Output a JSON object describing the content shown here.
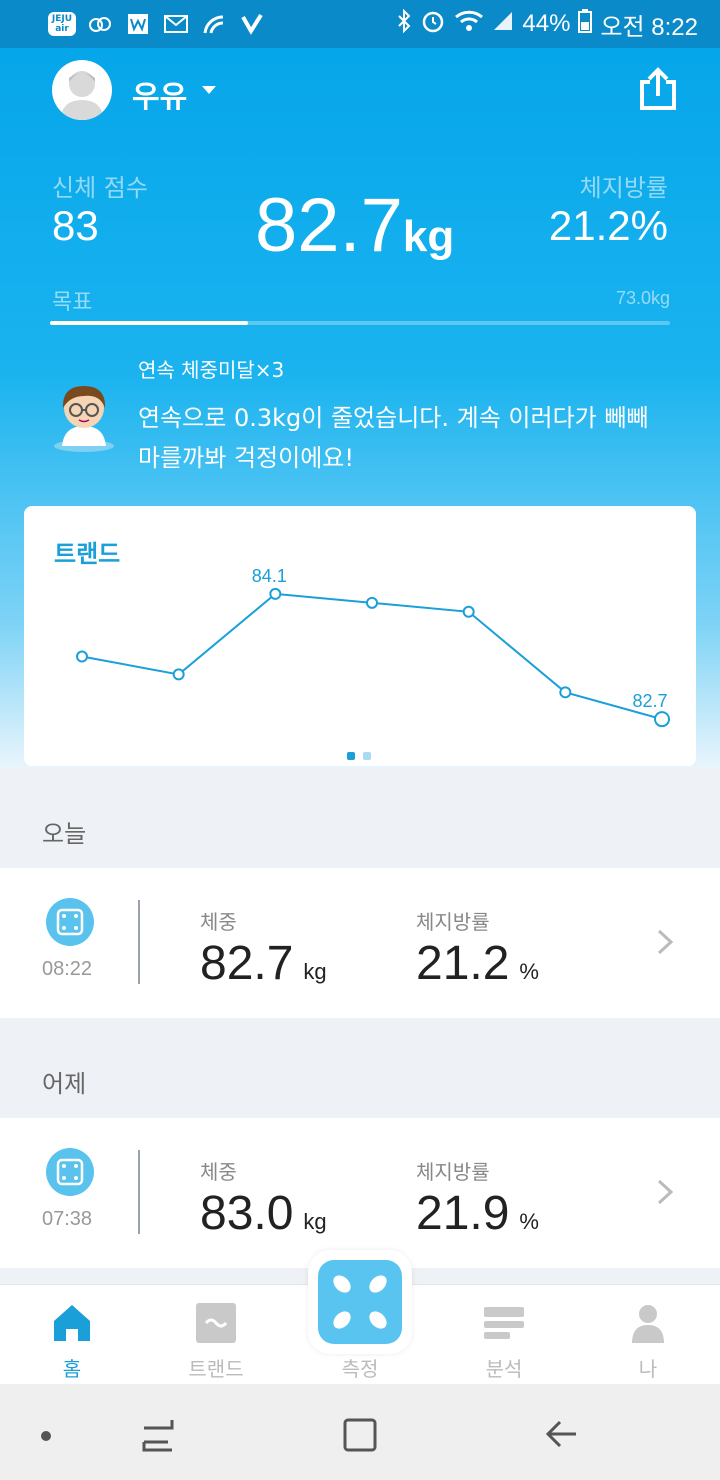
{
  "status_bar": {
    "icons_left": [
      "jeju-air-icon",
      "cloud-icon",
      "word-icon",
      "mail-icon",
      "wifi-call-icon",
      "check-icon"
    ],
    "jeju_label": "JEJU air",
    "battery": "44%",
    "time": "오전 8:22"
  },
  "profile": {
    "name": "우유"
  },
  "summary": {
    "body_score_label": "신체 점수",
    "body_score": "83",
    "weight": "82.7",
    "weight_unit": "kg",
    "body_fat_label": "체지방률",
    "body_fat": "21.2%",
    "goal_label": "목표",
    "goal_value": "73.0kg",
    "goal_progress": 0.32
  },
  "message": {
    "medal": "연속 체중미달×3",
    "text": "연속으로 0.3kg이 줄었습니다. 계속 이러다가 빼빼 마를까봐 걱정이에요!"
  },
  "trend": {
    "title": "트랜드",
    "page": 1,
    "pages": 2
  },
  "chart_data": {
    "type": "line",
    "title": "트랜드",
    "x": [
      1,
      2,
      3,
      4,
      5,
      6,
      7
    ],
    "series": [
      {
        "values": [
          83.4,
          83.2,
          84.1,
          84.0,
          83.9,
          83.0,
          82.7
        ]
      }
    ],
    "labels": [
      {
        "index": 2,
        "text": "84.1"
      },
      {
        "index": 6,
        "text": "82.7"
      }
    ],
    "ylim": [
      82.4,
      84.3
    ],
    "grid": false
  },
  "records": [
    {
      "section": "오늘",
      "time": "08:22",
      "weight_label": "체중",
      "weight": "82.7",
      "weight_unit": "kg",
      "fat_label": "체지방률",
      "fat": "21.2",
      "fat_unit": "%"
    },
    {
      "section": "어제",
      "time": "07:38",
      "weight_label": "체중",
      "weight": "83.0",
      "weight_unit": "kg",
      "fat_label": "체지방률",
      "fat": "21.9",
      "fat_unit": "%"
    }
  ],
  "nav": {
    "home": "홈",
    "trend": "트랜드",
    "measure": "측정",
    "analysis": "분석",
    "me": "나"
  },
  "colors": {
    "accent": "#1a9fd9",
    "header_top": "#06a6ea",
    "status_bar": "#0a8ac9"
  }
}
